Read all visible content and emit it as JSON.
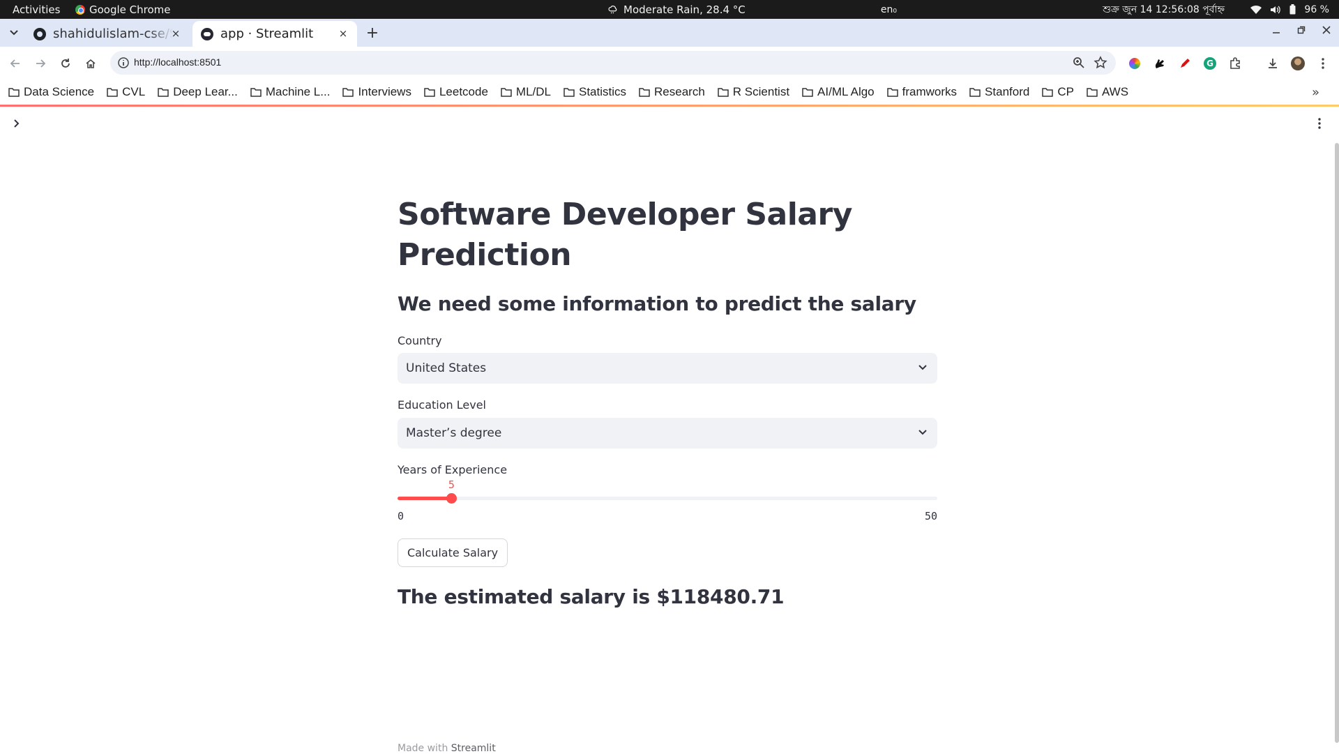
{
  "system_bar": {
    "activities": "Activities",
    "app_name": "Google Chrome",
    "weather": "Moderate Rain, 28.4 °C",
    "language": "en₀",
    "clock": "শুক্র জুন 14  12:56:08 পূর্বাহ্ন",
    "battery": "96 %"
  },
  "tabs": [
    {
      "title": "shahidulislam-cse/S",
      "close": "×"
    },
    {
      "title": "app · Streamlit",
      "close": "×"
    }
  ],
  "new_tab": "+",
  "omnibox": {
    "url": "http://localhost:8501"
  },
  "bookmarks": [
    "Data Science",
    "CVL",
    "Deep Lear...",
    "Machine L...",
    "Interviews",
    "Leetcode",
    "ML/DL",
    "Statistics",
    "Research",
    "R Scientist",
    "AI/ML Algo",
    "framworks",
    "Stanford",
    "CP",
    "AWS"
  ],
  "bookmarks_more": "»",
  "app": {
    "title": "Software Developer Salary Prediction",
    "subtitle": "We need some information to predict the salary",
    "country": {
      "label": "Country",
      "value": "United States"
    },
    "education": {
      "label": "Education Level",
      "value": "Master’s degree"
    },
    "experience": {
      "label": "Years of Experience",
      "value": 5,
      "min": 0,
      "max": 50,
      "value_text": "5",
      "min_text": "0",
      "max_text": "50"
    },
    "button_label": "Calculate Salary",
    "result": "The estimated salary is $118480.71",
    "footer_prefix": "Made with",
    "footer_brand": "Streamlit"
  },
  "colors": {
    "accent": "#ff4b4b",
    "text": "#31333f",
    "input_bg": "#f0f2f6",
    "tabstrip_bg": "#dfe7f7"
  }
}
